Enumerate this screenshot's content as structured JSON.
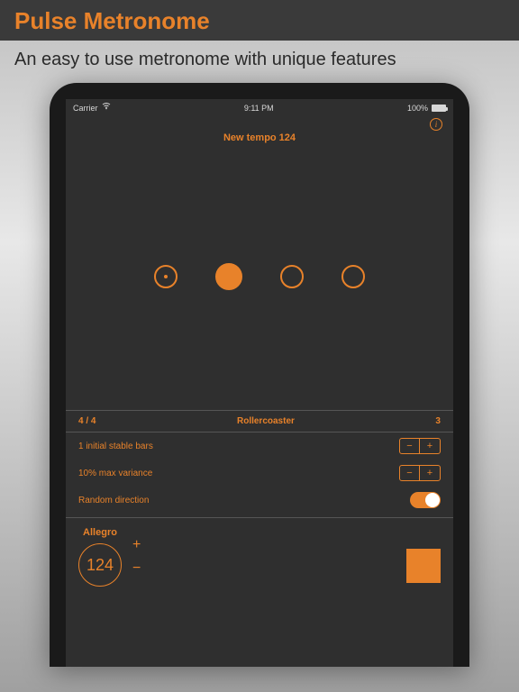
{
  "banner": {
    "title": "Pulse Metronome",
    "subtitle": "An easy to use metronome with unique features"
  },
  "status_bar": {
    "carrier": "Carrier",
    "wifi_icon": "wifi-icon",
    "time": "9:11 PM",
    "battery_pct": "100%"
  },
  "preset_name": "New tempo 124",
  "beats": [
    {
      "state": "accent-small"
    },
    {
      "state": "active-filled"
    },
    {
      "state": "hollow"
    },
    {
      "state": "hollow"
    }
  ],
  "pattern_bar": {
    "time_signature": "4 / 4",
    "pattern_name": "Rollercoaster",
    "count": "3"
  },
  "settings": {
    "initial_bars_label": "1 initial stable bars",
    "variance_label": "10% max variance",
    "random_label": "Random direction",
    "random_on": true,
    "stepper_minus": "−",
    "stepper_plus": "+"
  },
  "tempo": {
    "label": "Allegro",
    "value": "124",
    "plus": "+",
    "minus": "−"
  },
  "icons": {
    "info": "i"
  }
}
